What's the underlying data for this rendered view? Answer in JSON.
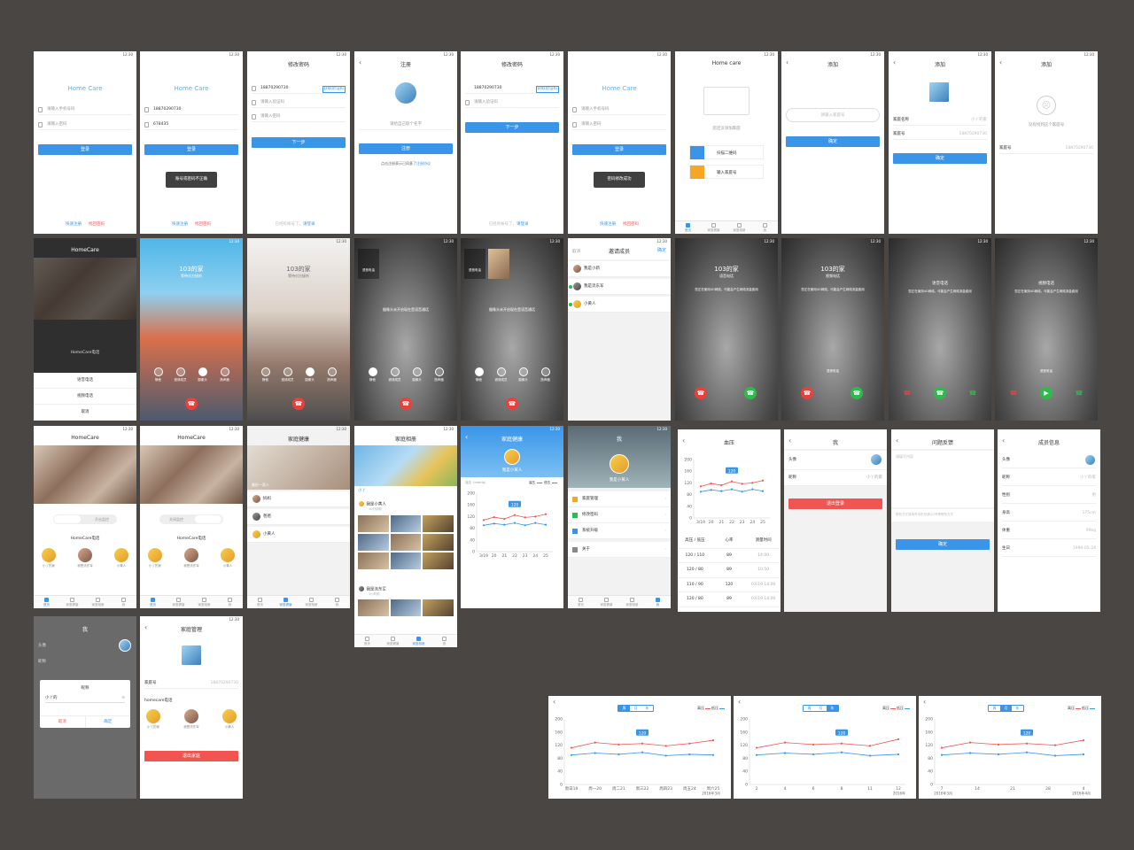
{
  "common": {
    "status_time": "12:30",
    "home_care": "Home Care",
    "home_care_title": "HomeCare",
    "home_care_lower": "Home care"
  },
  "login": {
    "phone_placeholder": "请输入手机号码",
    "password_placeholder": "请输入密码",
    "login_btn": "登录",
    "register": "快速注册",
    "forgot": "找回密码",
    "phone_value": "18870290730",
    "password_value": "678435",
    "error_toast": "账号或密码不正确",
    "success_toast": "密码修改成功"
  },
  "reset": {
    "title": "修改密码",
    "phone": "18870290730",
    "get_code": "获取验证码",
    "code_placeholder": "请输入验证码",
    "new_pw_placeholder": "请输入密码",
    "next_btn": "下一步",
    "have_account": "已经有帐号了，",
    "login_link": "请登录"
  },
  "register": {
    "title": "注册",
    "nickname_placeholder": "请给自己取个名字",
    "submit": "注册",
    "agree_prefix": "点击注册表示已同意了",
    "agree_link": "注册协议"
  },
  "homeempty": {
    "empty_text": "您还没添加家庭",
    "scan": "扫描二维码",
    "input_no": "输入家庭号"
  },
  "add": {
    "title": "添加",
    "no_placeholder": "请输入家庭号",
    "confirm": "确定",
    "family_name_label": "家庭名称",
    "family_name_value": "小丫的家",
    "family_no_label": "家庭号",
    "family_no_value": "18870290730",
    "not_found": "没有找到这个家庭号"
  },
  "call": {
    "family": "103的家",
    "waiting": "等待对方接听",
    "voice_call": "语音电话",
    "video_call": "视频电话",
    "cancel": "取消",
    "homecare_call": "HomeCare电话",
    "camera_off_tip": "摄像头未开启现在是语音通话",
    "using_4g": "您正在使用4G网络，可能会产生网络流量费用",
    "mute": "静音",
    "invite": "邀请成员",
    "camera": "摄像头",
    "speaker": "扬声器"
  },
  "invite": {
    "title": "邀请成员",
    "cancel": "取消",
    "ok": "确定",
    "members": [
      "我是小新",
      "我是流东军",
      "小黄人"
    ]
  },
  "members": [
    "小丫的家",
    "我是流东军",
    "小黄人"
  ],
  "toggle": {
    "video": "开启监控",
    "audio": "关闭监控"
  },
  "tabs": [
    "首页",
    "家庭健康",
    "家庭相册",
    "我"
  ],
  "health": {
    "title": "家庭健康",
    "family_label": "美好一家人",
    "list": [
      "妈妈",
      "爸爸",
      "小黄人"
    ],
    "user": "我是小黄人",
    "unit": "血压（mmHg）",
    "high": "高压",
    "low": "低压"
  },
  "album": {
    "title": "家庭相册",
    "tag": "小丫",
    "poster1": "我是小黄人",
    "poster2": "我是流东军",
    "time1": "10分钟前",
    "time2": "1小时前"
  },
  "me": {
    "title": "我",
    "name": "我是小黄人",
    "menu": [
      "家庭管理",
      "修改密码",
      "系统升级",
      "关于"
    ],
    "avatar": "头像",
    "nickname": "昵称",
    "nickname_value": "小丫的家",
    "logout": "退出登录"
  },
  "bp": {
    "title": "血压",
    "head": [
      "高压 / 低压",
      "心率",
      "测量时间"
    ],
    "rows": [
      [
        "120 / 110",
        "89",
        "14:00"
      ],
      [
        "120 / 80",
        "89",
        "10:50"
      ],
      [
        "110 / 90",
        "120",
        "03/19 14:00"
      ],
      [
        "120 / 80",
        "89",
        "03/19 14:00"
      ]
    ]
  },
  "feedback": {
    "title": "问题反馈",
    "content_placeholder": "请填写内容",
    "contact_placeholder": "联系方式请填写手机号或QQ号等联系方式",
    "submit": "确定"
  },
  "memberinfo": {
    "title": "成员信息",
    "fields": [
      [
        "头像",
        ""
      ],
      [
        "昵称",
        "小丫的家"
      ],
      [
        "性别",
        "男"
      ],
      [
        "身高",
        "175cm"
      ],
      [
        "体重",
        "99kg"
      ],
      [
        "生日",
        "1990-05-24"
      ]
    ]
  },
  "dialog": {
    "title": "昵称",
    "value": "小丫的",
    "cancel": "取消",
    "ok": "确定"
  },
  "familymgr": {
    "title": "家庭管理",
    "no_label": "家庭号",
    "no_value": "18870290730",
    "homecare_call": "homecare电话",
    "exit": "退出家庭"
  },
  "range": [
    "周",
    "月",
    "年"
  ],
  "chart_data": [
    {
      "type": "line",
      "title": "",
      "ylabel": "血压（mmHg）",
      "ylim": [
        0,
        200
      ],
      "x": [
        "3/19",
        "20",
        "21",
        "22",
        "23",
        "24",
        "25"
      ],
      "series": [
        {
          "name": "高压",
          "values": [
            108,
            118,
            112,
            125,
            117,
            120,
            128
          ],
          "color": "#f25451"
        },
        {
          "name": "低压",
          "values": [
            90,
            96,
            92,
            98,
            90,
            98,
            92
          ],
          "color": "#3a95e8"
        }
      ],
      "callout": "120"
    },
    {
      "type": "line",
      "ylim": [
        0,
        200
      ],
      "x": [
        "周日19",
        "周一20",
        "周二21",
        "周三22",
        "周四23",
        "周五24",
        "周六25"
      ],
      "x_sub": "2016年3月",
      "series": [
        {
          "name": "高压",
          "values": [
            112,
            128,
            122,
            125,
            118,
            125,
            135
          ],
          "color": "#f25451"
        },
        {
          "name": "低压",
          "values": [
            90,
            96,
            92,
            98,
            88,
            92,
            90
          ],
          "color": "#3a95e8"
        }
      ],
      "callout": "120"
    },
    {
      "type": "line",
      "ylim": [
        0,
        200
      ],
      "x": [
        "2",
        "4",
        "6",
        "8",
        "11",
        "12"
      ],
      "x_sub": "2016年",
      "series": [
        {
          "name": "高压",
          "values": [
            112,
            128,
            122,
            125,
            118,
            138
          ],
          "color": "#f25451"
        },
        {
          "name": "低压",
          "values": [
            90,
            96,
            92,
            98,
            88,
            92
          ],
          "color": "#3a95e8"
        }
      ],
      "callout": "120"
    },
    {
      "type": "line",
      "ylim": [
        0,
        200
      ],
      "x": [
        "7",
        "14",
        "21",
        "28",
        "4"
      ],
      "x_sub": [
        "2016年3月",
        "2016年4月"
      ],
      "series": [
        {
          "name": "高压",
          "values": [
            112,
            128,
            122,
            125,
            120,
            135
          ],
          "color": "#f25451"
        },
        {
          "name": "低压",
          "values": [
            90,
            96,
            92,
            98,
            88,
            92
          ],
          "color": "#3a95e8"
        }
      ],
      "callout": "120"
    }
  ]
}
